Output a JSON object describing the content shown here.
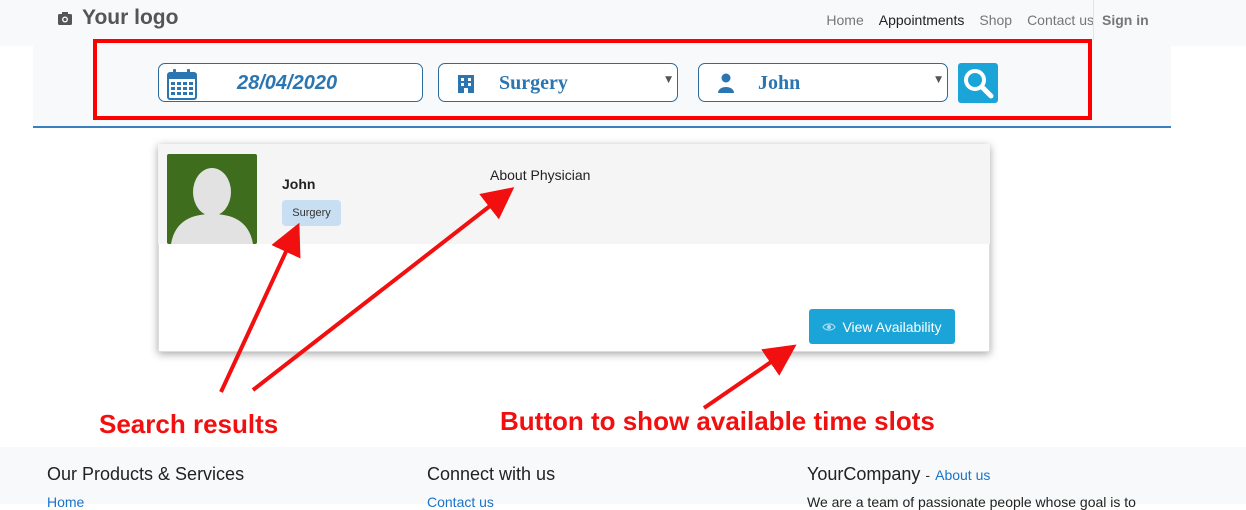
{
  "header": {
    "logo_text": "Your logo",
    "nav": [
      "Home",
      "Appointments",
      "Shop",
      "Contact us"
    ],
    "active_nav": "Appointments",
    "signin_label": "Sign in"
  },
  "search": {
    "date_value": "28/04/2020",
    "specialty_value": "Surgery",
    "doctor_value": "John",
    "icons": {
      "date": "calendar-icon",
      "specialty": "hospital-icon",
      "doctor": "user-icon",
      "submit": "search-icon"
    }
  },
  "result": {
    "doctor_name": "John",
    "specialty_badge": "Surgery",
    "about_label": "About Physician",
    "view_button_label": "View Availability"
  },
  "annotations": {
    "search_results": "Search results",
    "button_note": "Button to show available time slots"
  },
  "footer": {
    "col1_title": "Our Products & Services",
    "col1_link": "Home",
    "col2_title": "Connect with us",
    "col2_link": "Contact us",
    "col3_title": "YourCompany",
    "col3_separator": "-",
    "col3_link": "About us",
    "col3_text": "We are a team of passionate people whose goal is to"
  },
  "colors": {
    "accent": "#1aa4d8",
    "field_text": "#2b75b0",
    "annotation": "#f20f0f",
    "link": "#1a73c9"
  }
}
